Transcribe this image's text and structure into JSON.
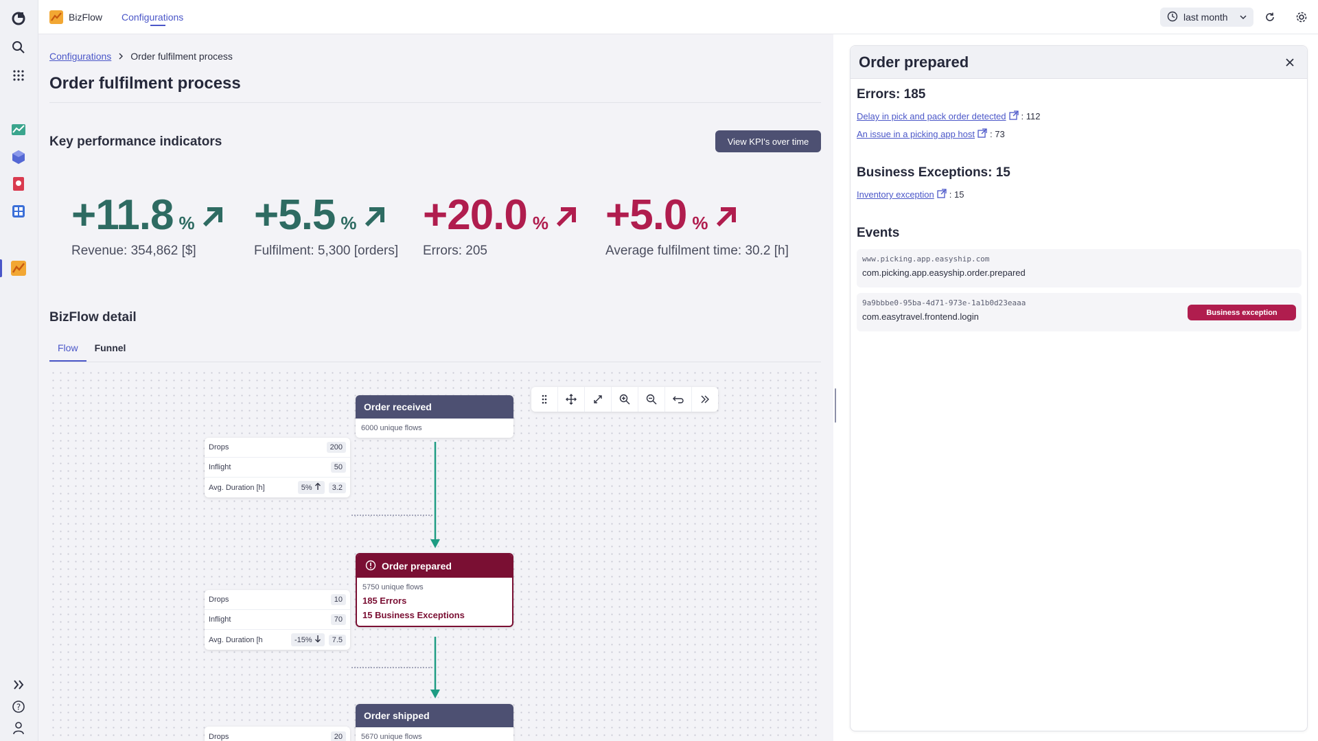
{
  "app": {
    "name": "BizFlow",
    "nav_item": "Configurations"
  },
  "header": {
    "timeframe": "last month"
  },
  "breadcrumb": {
    "parent": "Configurations",
    "current": "Order fulfilment process"
  },
  "page": {
    "title": "Order fulfilment process"
  },
  "kpi": {
    "section_title": "Key performance indicators",
    "button_label": "View KPI's over time",
    "items": [
      {
        "value": "+11.8",
        "unit": "%",
        "label": "Revenue: 354,862 [$]",
        "color": "#2e6b62"
      },
      {
        "value": "+5.5",
        "unit": "%",
        "label": "Fulfilment: 5,300 [orders]",
        "color": "#2e6b62"
      },
      {
        "value": "+20.0",
        "unit": "%",
        "label": "Errors: 205",
        "color": "#b01d4e"
      },
      {
        "value": "+5.0",
        "unit": "%",
        "label": "Average fulfilment time: 30.2 [h]",
        "color": "#b01d4e"
      }
    ]
  },
  "detail": {
    "section_title": "BizFlow detail",
    "tabs": [
      "Flow",
      "Funnel"
    ],
    "nodes": [
      {
        "title": "Order received",
        "flows": "6000 unique flows"
      },
      {
        "title": "Order prepared",
        "flows": "5750 unique flows",
        "errors": "185 Errors",
        "exceptions": "15 Business Exceptions"
      },
      {
        "title": "Order shipped",
        "flows": "5670 unique flows"
      }
    ],
    "stats": [
      {
        "drops_label": "Drops",
        "drops": "200",
        "inflight_label": "Inflight",
        "inflight": "50",
        "duration_label": "Avg. Duration [h]",
        "change": "5%",
        "duration": "3.2"
      },
      {
        "drops_label": "Drops",
        "drops": "10",
        "inflight_label": "Inflight",
        "inflight": "70",
        "duration_label": "Avg. Duration [h",
        "change": "-15%",
        "duration": "7.5"
      },
      {
        "drops_label": "Drops",
        "drops": "20"
      }
    ]
  },
  "panel": {
    "title": "Order prepared",
    "errors_heading": "Errors: 185",
    "error_links": [
      {
        "text": "Delay in pick and pack order detected",
        "count": ": 112"
      },
      {
        "text": "An issue in a picking app host",
        "count": ": 73"
      }
    ],
    "exceptions_heading": "Business Exceptions: 15",
    "exception_links": [
      {
        "text": "Inventory exception",
        "count": ": 15"
      }
    ],
    "events_heading": "Events",
    "events": [
      {
        "source": "www.picking.app.easyship.com",
        "name": "com.picking.app.easyship.order.prepared"
      },
      {
        "source": "9a9bbbe0-95ba-4d71-973e-1a1b0d23eaaa",
        "name": "com.easytravel.frontend.login",
        "badge": "Business exception"
      }
    ]
  }
}
